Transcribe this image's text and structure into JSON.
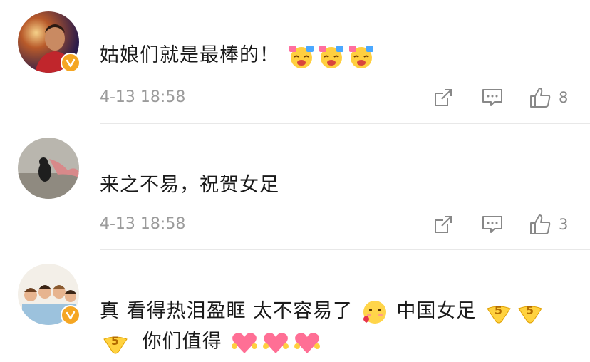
{
  "comments": [
    {
      "text": "姑娘们就是最棒的！",
      "time": "4-13 18:58",
      "like_count": "8",
      "verified": true,
      "emojis": [
        "doge-cheer-emoji",
        "doge-cheer-emoji",
        "doge-cheer-emoji"
      ]
    },
    {
      "text": "来之不易，祝贺女足",
      "time": "4-13 18:58",
      "like_count": "3",
      "verified": false
    },
    {
      "text_part1": "真 看得热泪盈眶 太不容易了",
      "text_part2": "中国女足",
      "text_part3": "你们值得",
      "verified": true
    }
  ],
  "colors": {
    "badge": "#f5a623",
    "meta": "#9b9b9b",
    "heart": "#ff5f8a"
  }
}
